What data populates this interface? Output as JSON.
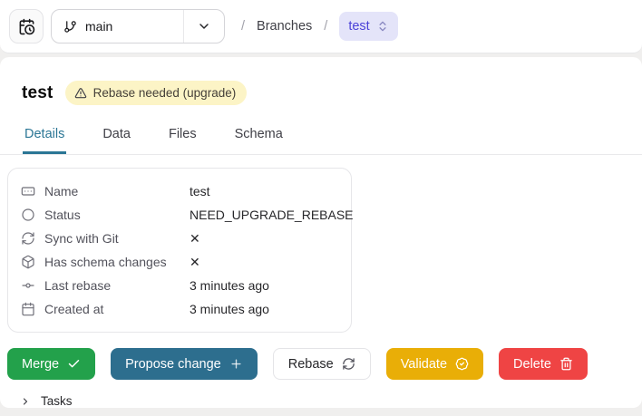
{
  "topbar": {
    "history_button_icon": "calendar-clock-icon",
    "branch_selector": {
      "value": "main",
      "icon": "git-branch-icon"
    },
    "breadcrumb": {
      "sep1": "/",
      "section": "Branches",
      "sep2": "/",
      "current": "test"
    }
  },
  "header": {
    "title": "test",
    "badge": "Rebase needed (upgrade)"
  },
  "tabs": [
    {
      "label": "Details",
      "active": true
    },
    {
      "label": "Data",
      "active": false
    },
    {
      "label": "Files",
      "active": false
    },
    {
      "label": "Schema",
      "active": false
    }
  ],
  "details": {
    "rows": [
      {
        "icon": "name-field-icon",
        "label": "Name",
        "value": "test"
      },
      {
        "icon": "status-circle-icon",
        "label": "Status",
        "value": "NEED_UPGRADE_REBASE"
      },
      {
        "icon": "sync-icon",
        "label": "Sync with Git",
        "value": "✕"
      },
      {
        "icon": "box-icon",
        "label": "Has schema changes",
        "value": "✕"
      },
      {
        "icon": "git-commit-icon",
        "label": "Last rebase",
        "value": "3 minutes ago"
      },
      {
        "icon": "calendar-icon",
        "label": "Created at",
        "value": "3 minutes ago"
      }
    ]
  },
  "actions": [
    {
      "label": "Merge",
      "icon": "check-icon",
      "color": "#23a14b"
    },
    {
      "label": "Propose change",
      "icon": "plus-icon",
      "color": "#2d6e8e"
    },
    {
      "label": "Rebase",
      "icon": "refresh-icon",
      "color": "#ffffff"
    },
    {
      "label": "Validate",
      "icon": "badge-check-icon",
      "color": "#e9ae07"
    },
    {
      "label": "Delete",
      "icon": "trash-icon",
      "color": "#ef4444"
    }
  ],
  "tasks": {
    "label": "Tasks"
  },
  "colors": {
    "active_tab": "#2b7695",
    "badge_bg": "#fcf4c6",
    "breadcrumb_current_text": "#4c43d8",
    "breadcrumb_current_bg": "#e4e4f9",
    "page_bg": "#f0efee"
  }
}
